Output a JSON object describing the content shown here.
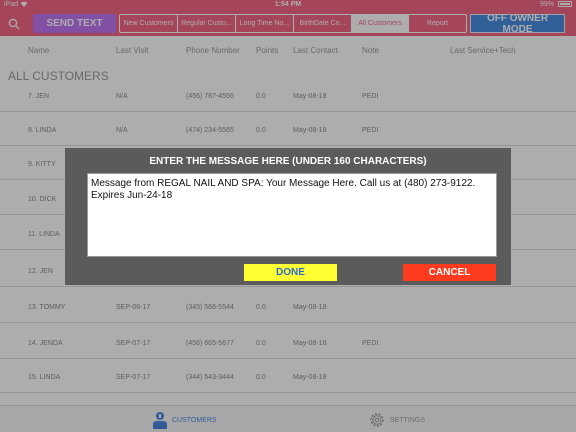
{
  "status_bar": {
    "device": "iPad",
    "time": "1:54 PM",
    "battery": "99%"
  },
  "icons": {
    "search": "search-icon",
    "wifi": "wifi-icon",
    "battery": "battery-icon",
    "customers": "customers-icon",
    "settings": "gear-icon"
  },
  "toolbar": {
    "send_text": "SEND TEXT",
    "tabs": [
      {
        "label": "New Customers"
      },
      {
        "label": "Regular Custo..."
      },
      {
        "label": "Long Time No..."
      },
      {
        "label": "BirthDate Co..."
      },
      {
        "label": "All Customers"
      },
      {
        "label": "Report"
      }
    ],
    "active_tab": "All Customers",
    "owner_mode": "OFF OWNER MODE"
  },
  "table": {
    "headers": {
      "name": "Name",
      "last_visit": "Last Visit",
      "phone": "Phone Number",
      "points": "Points",
      "last_contact": "Last Contact",
      "note": "Note",
      "last_service": "Last Service+Tech"
    },
    "section_title": "ALL CUSTOMERS",
    "rows": [
      {
        "name": "7. JEN",
        "last_visit": "N/A",
        "phone": "(456) 787-4556",
        "points": "0.0",
        "last_contact": "May-08-18",
        "note": "PEDI"
      },
      {
        "name": "8. LINDA",
        "last_visit": "N/A",
        "phone": "(474) 234-5565",
        "points": "0.0",
        "last_contact": "May-08-18",
        "note": "PEDI"
      },
      {
        "name": "9. KITTY",
        "last_visit": "",
        "phone": "",
        "points": "",
        "last_contact": "",
        "note": ""
      },
      {
        "name": "10. DICK",
        "last_visit": "",
        "phone": "",
        "points": "",
        "last_contact": "",
        "note": ""
      },
      {
        "name": "11. LINDA",
        "last_visit": "",
        "phone": "",
        "points": "",
        "last_contact": "",
        "note": ""
      },
      {
        "name": "12. JEN",
        "last_visit": "",
        "phone": "",
        "points": "",
        "last_contact": "",
        "note": ""
      },
      {
        "name": "13. TOMMY",
        "last_visit": "SEP-06-17",
        "phone": "(345) 566-5544",
        "points": "0.0",
        "last_contact": "May-08-18",
        "note": ""
      },
      {
        "name": "14. JENDA",
        "last_visit": "SEP-07-17",
        "phone": "(456) 665-5677",
        "points": "0.0",
        "last_contact": "May-08-18",
        "note": "PEDI"
      },
      {
        "name": "15. LINDA",
        "last_visit": "SEP-07-17",
        "phone": "(344) 543-3444",
        "points": "0.0",
        "last_contact": "May-08-18",
        "note": ""
      }
    ]
  },
  "dialog": {
    "title": "ENTER THE MESSAGE HERE (UNDER 160 CHARACTERS)",
    "message": "Message from REGAL NAIL AND SPA: Your Message Here. Call us at (480) 273-9122. Expires Jun-24-18",
    "done": "DONE",
    "cancel": "CANCEL"
  },
  "tabbar": {
    "customers": "CUSTOMERS",
    "settings": "SETTINGS"
  },
  "colors": {
    "accent": "#f24c6e",
    "send_text": "#b45df0",
    "owner_mode": "#2a7bdc",
    "done": "#ffff33",
    "cancel": "#ff3b1f",
    "tab_active": "#2b74d6"
  }
}
